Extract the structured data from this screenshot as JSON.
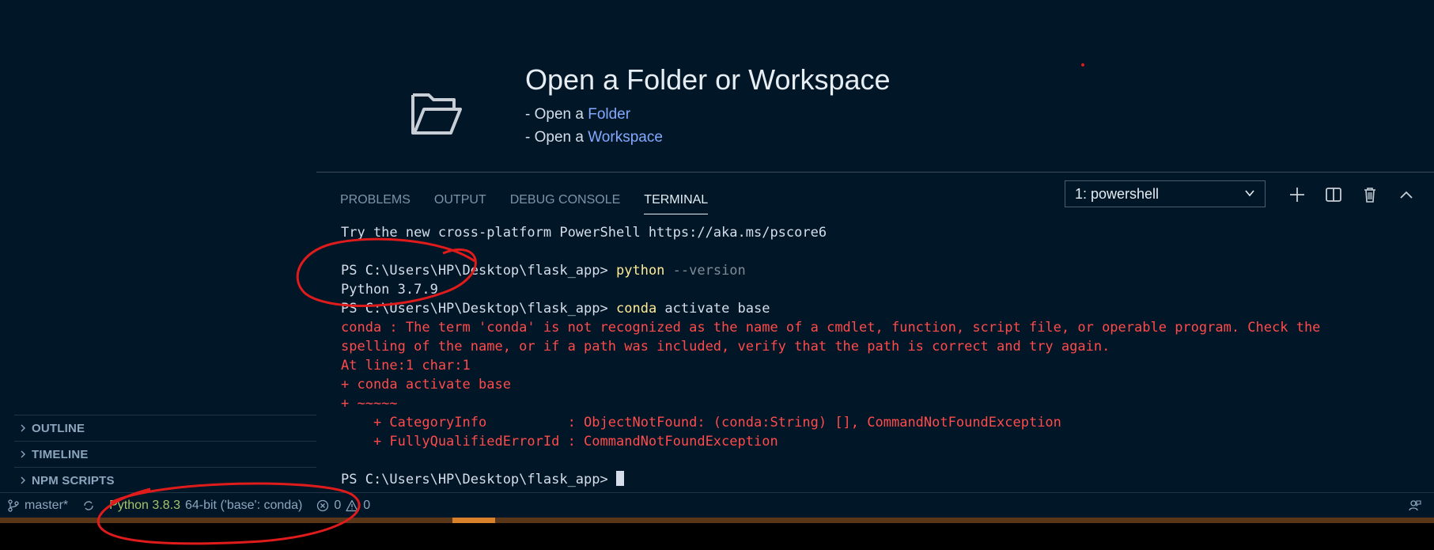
{
  "welcome": {
    "title": "Open a Folder or Workspace",
    "line1_prefix": "- Open a ",
    "line1_link": "Folder",
    "line2_prefix": "- Open a ",
    "line2_link": "Workspace"
  },
  "panel": {
    "tabs": [
      {
        "label": "PROBLEMS"
      },
      {
        "label": "OUTPUT"
      },
      {
        "label": "DEBUG CONSOLE"
      },
      {
        "label": "TERMINAL"
      }
    ],
    "active_tab": "TERMINAL",
    "terminal_select": "1: powershell"
  },
  "terminal": {
    "line1": "Try the new cross-platform PowerShell https://aka.ms/pscore6",
    "prompt": "PS C:\\Users\\HP\\Desktop\\flask_app> ",
    "cmd1": "python",
    "cmd1_arg": " --version",
    "out1": "Python 3.7.9",
    "cmd2_a": "conda",
    "cmd2_b": " activate base",
    "err1": "conda : The term 'conda' is not recognized as the name of a cmdlet, function, script file, or operable program. Check the",
    "err2": "spelling of the name, or if a path was included, verify that the path is correct and try again.",
    "err3": "At line:1 char:1",
    "err4": "+ conda activate base",
    "err5": "+ ~~~~~",
    "err6": "    + CategoryInfo          : ObjectNotFound: (conda:String) [], CommandNotFoundException",
    "err7": "    + FullyQualifiedErrorId : CommandNotFoundException"
  },
  "sidebar": {
    "sections": [
      {
        "label": "OUTLINE"
      },
      {
        "label": "TIMELINE"
      },
      {
        "label": "NPM SCRIPTS"
      }
    ]
  },
  "statusbar": {
    "branch": "master*",
    "python": "Python 3.8.3",
    "env": "64-bit ('base': conda)",
    "errors": "0",
    "warnings": "0"
  },
  "icons": {
    "folder": "folder-open-icon",
    "chevron": "chevron-right-icon",
    "select": "chevron-down-icon",
    "add": "plus-icon",
    "split": "split-icon",
    "trash": "trash-icon",
    "maximize": "chevron-up-icon",
    "branch": "git-branch-icon",
    "sync": "sync-icon",
    "error": "error-icon",
    "warning": "warning-icon",
    "feedback": "feedback-icon"
  },
  "colors": {
    "background": "#011627",
    "error_text": "#ff4b4b",
    "command": "#ffeb95",
    "link": "#82aaff",
    "python_status": "#a6c36a",
    "annotation": "#e01b1b"
  }
}
